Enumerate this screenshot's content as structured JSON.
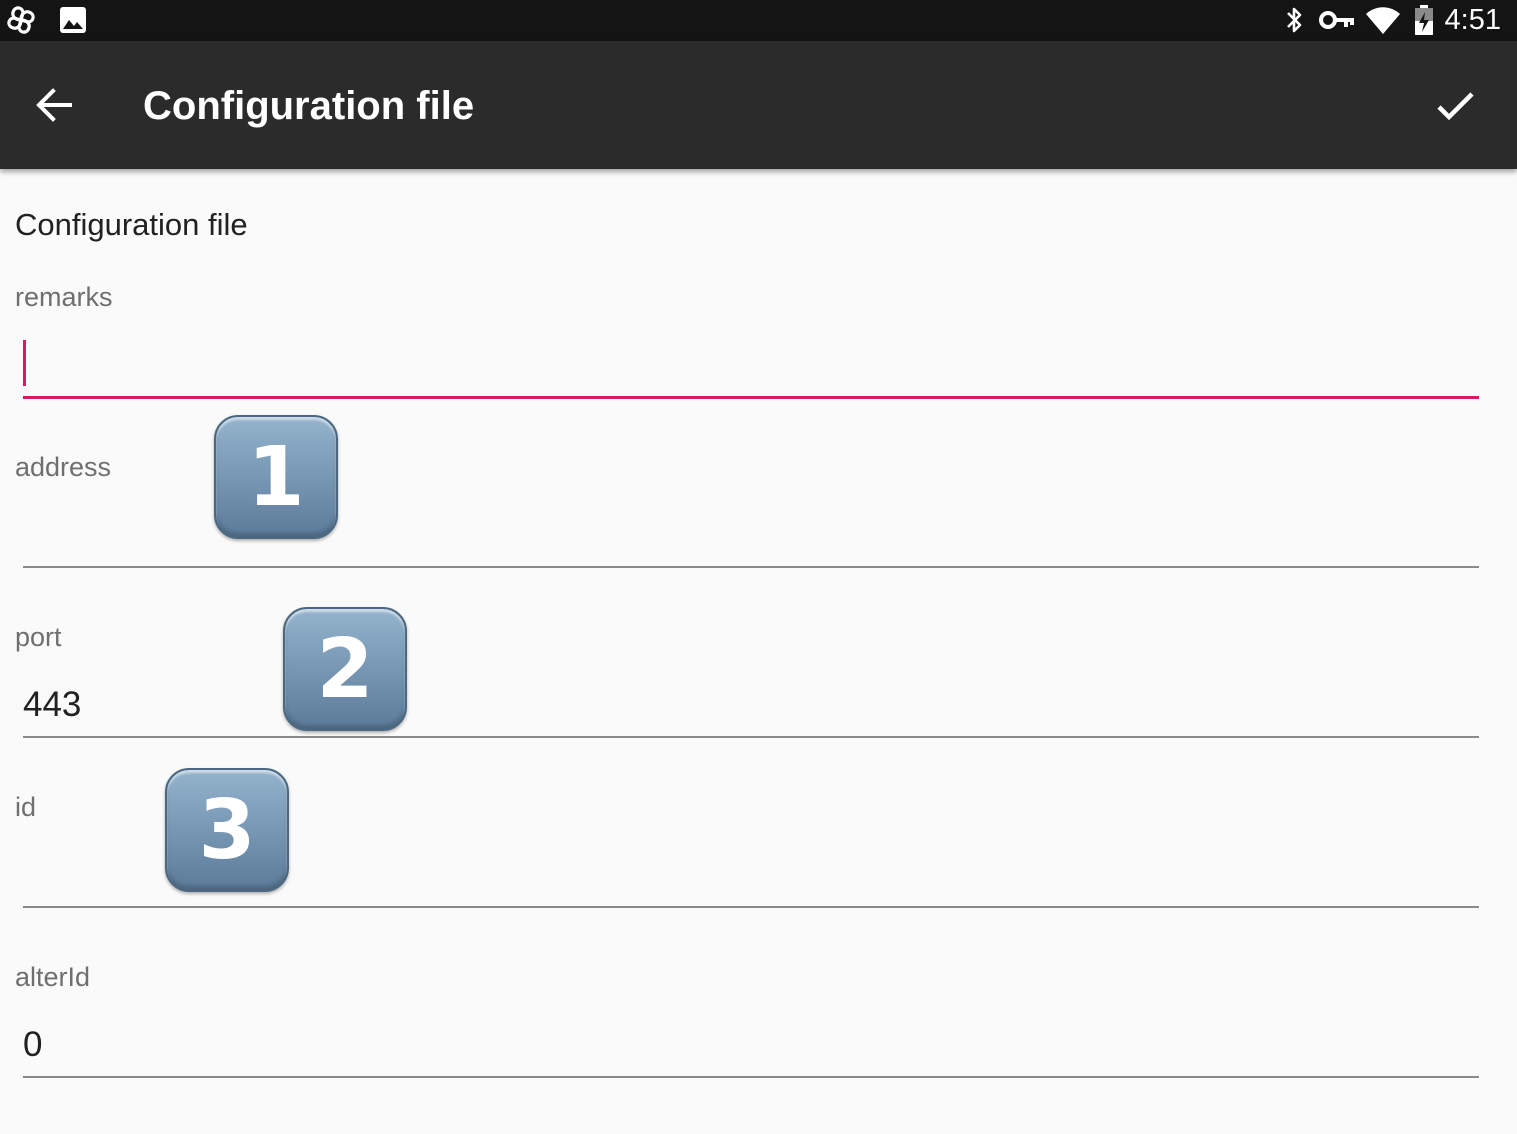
{
  "status_bar": {
    "time": "4:51",
    "left_icons": [
      "pinwheel-icon",
      "image-icon"
    ],
    "right_icons": [
      "bluetooth-icon",
      "vpn-key-icon",
      "wifi-icon",
      "battery-charging-icon"
    ]
  },
  "toolbar": {
    "title": "Configuration file",
    "back_icon": "arrow-back-icon",
    "confirm_icon": "check-icon",
    "background": "#2b2b2b"
  },
  "form": {
    "heading": "Configuration file",
    "accent_color": "#d81b60",
    "fields": [
      {
        "label": "remarks",
        "value": "",
        "focused": true
      },
      {
        "label": "address",
        "value": ""
      },
      {
        "label": "port",
        "value": "443"
      },
      {
        "label": "id",
        "value": ""
      },
      {
        "label": "alterId",
        "value": "0"
      }
    ]
  },
  "badges": [
    "1",
    "2",
    "3"
  ]
}
